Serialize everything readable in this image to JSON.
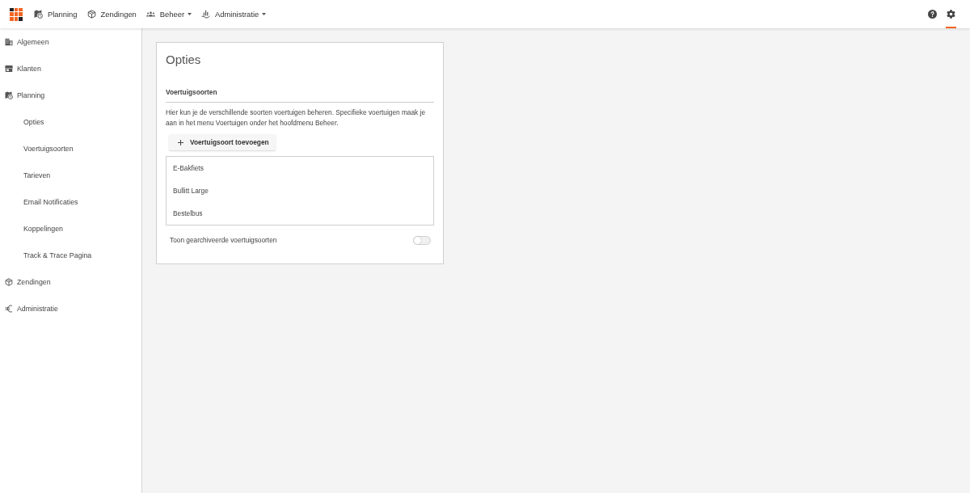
{
  "top_nav": {
    "items": [
      {
        "kind": "planning",
        "label": "Planning",
        "dropdown": false
      },
      {
        "kind": "shipments",
        "label": "Zendingen",
        "dropdown": false
      },
      {
        "kind": "management",
        "label": "Beheer",
        "dropdown": true
      },
      {
        "kind": "administration",
        "label": "Administratie",
        "dropdown": true
      }
    ],
    "actions": [
      {
        "kind": "help",
        "selected": false
      },
      {
        "kind": "settings",
        "selected": true
      }
    ]
  },
  "sidebar": {
    "items": [
      {
        "kind": "general",
        "label": "Algemeen"
      },
      {
        "kind": "customers",
        "label": "Klanten"
      },
      {
        "kind": "planning",
        "label": "Planning",
        "children": [
          {
            "label": "Opties"
          },
          {
            "label": "Voertuigsoorten"
          },
          {
            "label": "Tarieven"
          },
          {
            "label": "Email Notificaties"
          },
          {
            "label": "Koppelingen"
          },
          {
            "label": "Track & Trace Pagina"
          }
        ]
      },
      {
        "kind": "shipments",
        "label": "Zendingen"
      },
      {
        "kind": "administration",
        "label": "Administratie"
      }
    ]
  },
  "card": {
    "title": "Opties",
    "section": {
      "heading": "Voertuigsoorten",
      "description": "Hier kun je de verschillende soorten voertuigen beheren. Specifieke voertuigen maak je aan in het menu Voertuigen onder het hoofdmenu Beheer.",
      "add_button": {
        "label": "Voertuigsoort toevoegen"
      },
      "vehicle_types": [
        "E-Bakfiets",
        "Bullitt Large",
        "Bestelbus"
      ],
      "archived_toggle": {
        "label": "Toon gearchiveerde voertuigsoorten",
        "on": false
      }
    }
  }
}
